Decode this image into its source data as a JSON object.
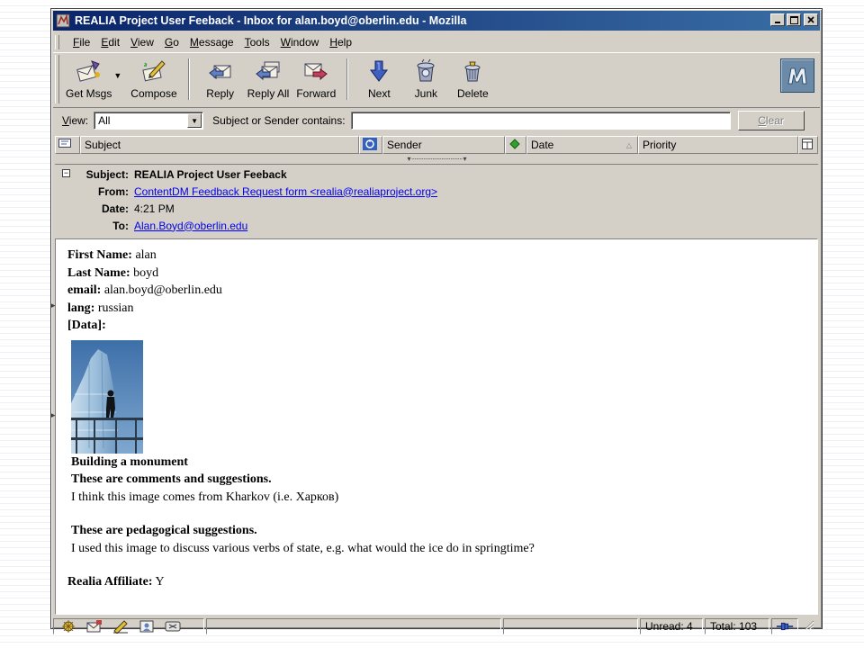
{
  "window": {
    "title": "REALIA Project User Feeback - Inbox for alan.boyd@oberlin.edu - Mozilla",
    "controls": {
      "minimize": "_",
      "maximize": "□",
      "close": "×"
    }
  },
  "menubar": {
    "items": [
      {
        "mnemonic": "F",
        "rest": "ile"
      },
      {
        "mnemonic": "E",
        "rest": "dit"
      },
      {
        "mnemonic": "V",
        "rest": "iew"
      },
      {
        "mnemonic": "G",
        "rest": "o"
      },
      {
        "mnemonic": "M",
        "rest": "essage"
      },
      {
        "mnemonic": "T",
        "rest": "ools"
      },
      {
        "mnemonic": "W",
        "rest": "indow"
      },
      {
        "mnemonic": "H",
        "rest": "elp"
      }
    ]
  },
  "toolbar": {
    "get_msgs": "Get Msgs",
    "compose": "Compose",
    "reply": "Reply",
    "reply_all": "Reply All",
    "forward": "Forward",
    "next": "Next",
    "junk": "Junk",
    "delete": "Delete",
    "logo_icon": "mozilla-m-logo"
  },
  "filterbar": {
    "view_mnemonic": "V",
    "view_rest": "iew:",
    "view_value": "All",
    "search_label": "Subject or Sender contains:",
    "search_value": "",
    "clear_mnemonic": "C",
    "clear_rest": "lear"
  },
  "thread_columns": {
    "subject": "Subject",
    "sender": "Sender",
    "date": "Date",
    "priority": "Priority"
  },
  "message_header": {
    "subject_label": "Subject:",
    "subject": "REALIA Project User Feeback",
    "from_label": "From:",
    "from": "ContentDM Feedback Request form <realia@realiaproject.org>",
    "date_label": "Date:",
    "date": "4:21 PM",
    "to_label": "To:",
    "to": "Alan.Boyd@oberlin.edu"
  },
  "message_body": {
    "first_name_label": "First Name",
    "first_name": "alan",
    "last_name_label": "Last Name",
    "last_name": "boyd",
    "email_label": "email",
    "email": "alan.boyd@oberlin.edu",
    "lang_label": "lang",
    "lang": "russian",
    "data_label": "[Data]",
    "image_title": "Building a monument",
    "comments_heading": "These are comments and suggestions.",
    "comments_text": "I think this image comes from Kharkov (i.e. Харков)",
    "pedagogical_heading": "These are pedagogical suggestions.",
    "pedagogical_text": "I used this image to discuss various verbs of state, e.g. what would the ice do in springtime?",
    "affiliate_label": "Realia Affiliate",
    "affiliate_value": "Y"
  },
  "statusbar": {
    "unread": "Unread: 4",
    "total": "Total: 103"
  },
  "colors": {
    "chrome": "#d4d0c8",
    "titlebar_start": "#0a246a",
    "titlebar_end": "#3a6ea5",
    "link": "#0000ee"
  }
}
